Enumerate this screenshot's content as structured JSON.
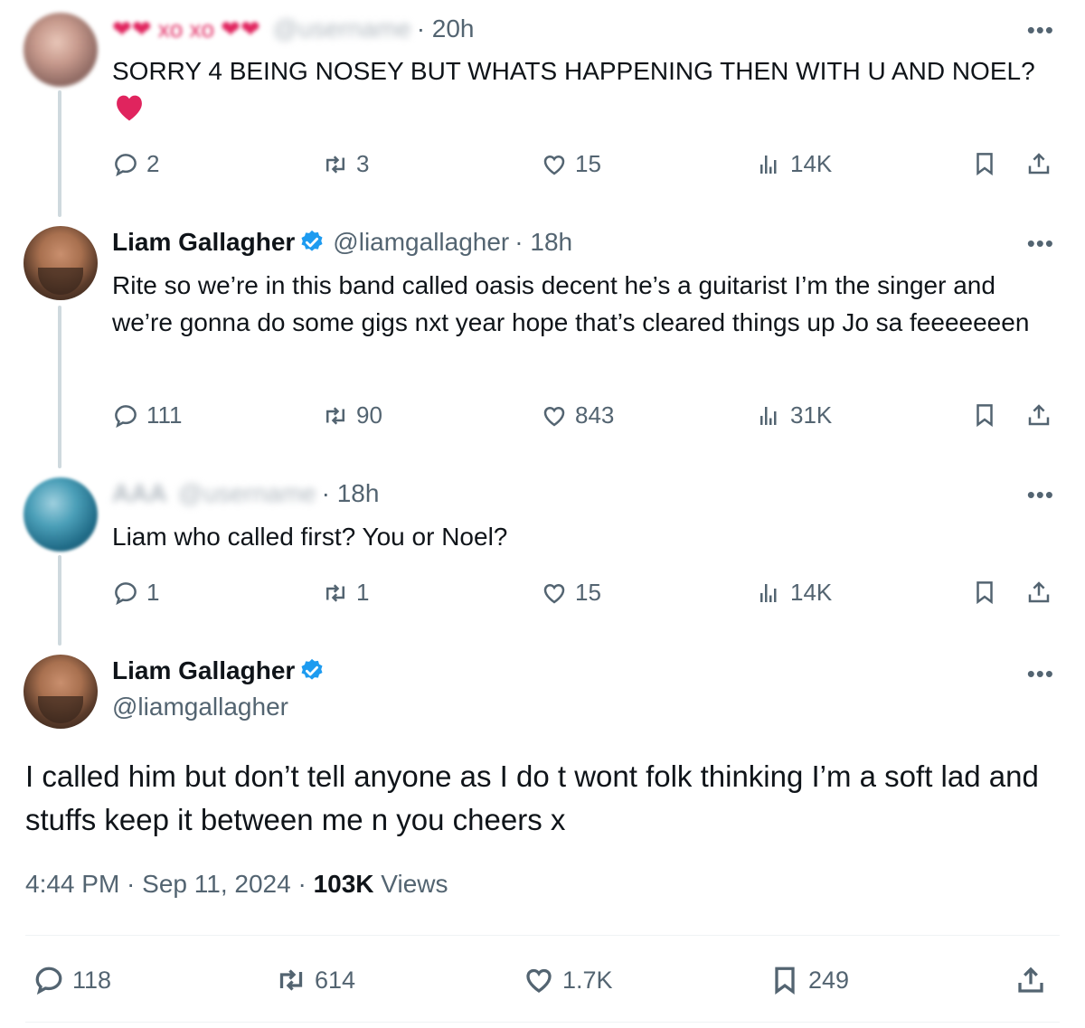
{
  "tweets": [
    {
      "author_blurred": "xo xo",
      "handle_blurred": "@username",
      "time": "· 20h",
      "text": "SORRY 4 BEING NOSEY BUT WHATS HAPPENING THEN WITH U AND NOEL?",
      "emoji": "heart",
      "replies": "2",
      "retweets": "3",
      "likes": "15",
      "views": "14K"
    },
    {
      "author": "Liam Gallagher",
      "handle": "@liamgallagher",
      "time": "· 18h",
      "text": "Rite so we’re in this band called oasis decent he’s a guitarist I’m the singer and we’re gonna do some gigs nxt year hope that’s cleared things up Jo sa feeeeeeen",
      "replies": "111",
      "retweets": "90",
      "likes": "843",
      "views": "31K"
    },
    {
      "author_blurred": "AAA",
      "handle_blurred": "@username",
      "time": "· 18h",
      "text": "Liam who called first? You or Noel?",
      "replies": "1",
      "retweets": "1",
      "likes": "15",
      "views": "14K"
    }
  ],
  "main": {
    "author": "Liam Gallagher",
    "handle": "@liamgallagher",
    "text": "I called him but don’t tell anyone as I do t wont folk thinking I’m a soft lad and stuffs keep it between me n you cheers x",
    "time": "4:44 PM",
    "date": "Sep 11, 2024",
    "views_count": "103K",
    "views_label": "Views",
    "replies": "118",
    "retweets": "614",
    "likes": "1.7K",
    "bookmarks": "249"
  },
  "colors": {
    "verified": "#1d9bf0",
    "text": "#0f1419",
    "secondary": "#536471",
    "emoji_heart": "#e0245e"
  }
}
